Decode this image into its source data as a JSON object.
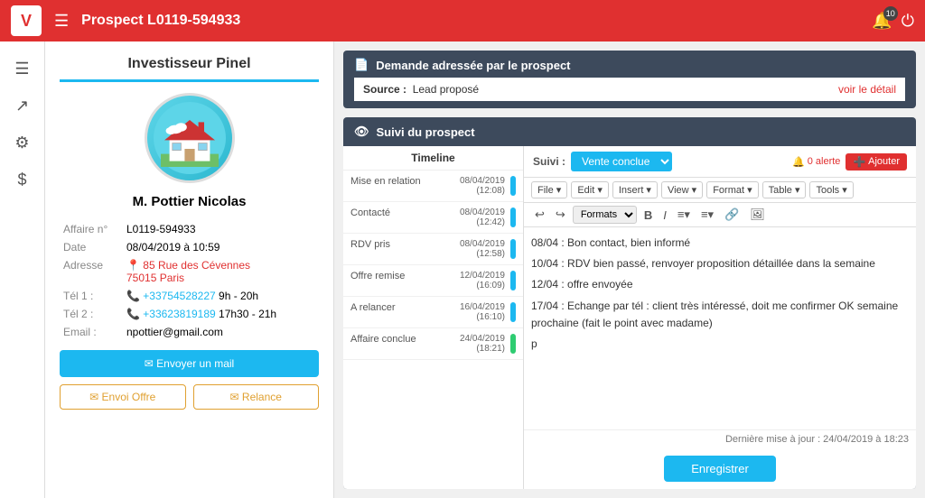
{
  "navbar": {
    "logo": "V",
    "title": "Prospect L0119-594933",
    "bell_count": "10",
    "hamburger": "☰"
  },
  "sidebar": {
    "icons": [
      "☰",
      "↗",
      "⚙",
      "$"
    ]
  },
  "left_panel": {
    "section_title": "Investisseur Pinel",
    "person_name_title": "M. Pottier",
    "person_name_sub": "Nicolas",
    "fields": [
      {
        "label": "Affaire n°",
        "value": "L0119-594933",
        "type": "normal"
      },
      {
        "label": "Date",
        "value": "08/04/2019 à 10:59",
        "type": "normal"
      },
      {
        "label": "Adresse",
        "value": "85 Rue des Cévennes",
        "value2": "75015 Paris",
        "type": "red"
      },
      {
        "label": "Tél 1 :",
        "value": "+33754528227",
        "extra": "9h - 20h",
        "type": "blue"
      },
      {
        "label": "Tél 2 :",
        "value": "+33623819189",
        "extra": "17h30 - 21h",
        "type": "blue"
      },
      {
        "label": "Email :",
        "value": "npottier@gmail.com",
        "type": "normal"
      }
    ],
    "btn_mail": "✉ Envoyer un mail",
    "btn_offre": "✉ Envoi Offre",
    "btn_relance": "✉ Relance"
  },
  "demande": {
    "title": "Demande adressée par le prospect",
    "source_label": "Source :",
    "source_value": "Lead proposé",
    "voir_detail": "voir le détail"
  },
  "suivi": {
    "title": "Suivi du prospect",
    "label": "Suivi :",
    "select_value": "Vente conclue",
    "alerte": "0 alerte",
    "ajouter": "Ajouter",
    "timeline_header": "Timeline",
    "timeline_items": [
      {
        "label": "Mise en relation",
        "date": "08/04/2019",
        "time": "(12:08)",
        "bar": "cyan"
      },
      {
        "label": "Contacté",
        "date": "08/04/2019",
        "time": "(12:42)",
        "bar": "cyan"
      },
      {
        "label": "RDV pris",
        "date": "08/04/2019",
        "time": "(12:58)",
        "bar": "cyan"
      },
      {
        "label": "Offre remise",
        "date": "12/04/2019",
        "time": "(16:09)",
        "bar": "cyan"
      },
      {
        "label": "A relancer",
        "date": "16/04/2019",
        "time": "(16:10)",
        "bar": "cyan"
      },
      {
        "label": "Affaire conclue",
        "date": "24/04/2019",
        "time": "(18:21)",
        "bar": "green"
      }
    ],
    "menu_items": [
      "File ▾",
      "Edit ▾",
      "Insert ▾",
      "View ▾",
      "Format ▾",
      "Table ▾",
      "Tools ▾"
    ],
    "content_lines": [
      "08/04 : Bon contact, bien informé",
      "10/04 : RDV bien passé, renvoyer proposition détaillée dans la semaine",
      "12/04 : offre envoyée",
      "17/04 : Echange par tél : client très intéressé, doit me confirmer OK semaine prochaine (fait le point avec madame)"
    ],
    "content_cursor": "p",
    "last_update": "Dernière mise à jour : 24/04/2019 à 18:23",
    "save_btn": "Enregistrer"
  }
}
